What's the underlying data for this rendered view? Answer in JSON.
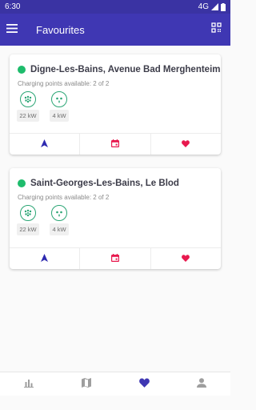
{
  "status_bar": {
    "time": "6:30",
    "network": "4G"
  },
  "app_bar": {
    "title": "Favourites"
  },
  "favourites": [
    {
      "name": "Digne-Les-Bains, Avenue Bad Merghenteim",
      "availability": "Charging points available: 2 of 2",
      "status_color": "#1ebc6c",
      "plugs": [
        {
          "type": "type2-icon",
          "power": "22 kW"
        },
        {
          "type": "domestic-plug-icon",
          "power": "4 kW"
        }
      ]
    },
    {
      "name": "Saint-Georges-Les-Bains, Le Blod",
      "availability": "Charging points available: 2 of 2",
      "status_color": "#1ebc6c",
      "plugs": [
        {
          "type": "type2-icon",
          "power": "22 kW"
        },
        {
          "type": "domestic-plug-icon",
          "power": "4 kW"
        }
      ]
    }
  ],
  "colors": {
    "primary": "#3f37b3",
    "status_bar": "#3a33a3",
    "available": "#1ebc6c",
    "accent": "#e8194e",
    "navigate": "#2e2ab0"
  }
}
